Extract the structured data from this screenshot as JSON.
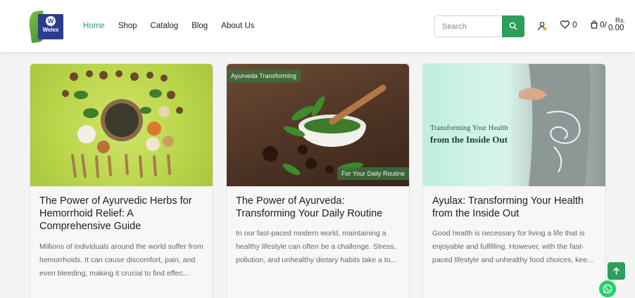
{
  "brand": {
    "logo_text": "Welex",
    "logo_badge": "W"
  },
  "nav": [
    {
      "label": "Home",
      "active": true
    },
    {
      "label": "Shop",
      "active": false
    },
    {
      "label": "Catalog",
      "active": false
    },
    {
      "label": "Blog",
      "active": false
    },
    {
      "label": "About Us",
      "active": false
    }
  ],
  "search": {
    "placeholder": "Search",
    "value": ""
  },
  "header_actions": {
    "wishlist_count": "0",
    "cart_count": "0/",
    "cart_currency": "Rs.",
    "cart_total": "0.00"
  },
  "cards": [
    {
      "title": "The Power of Ayurvedic Herbs for Hemorrhoid Relief: A Comprehensive Guide",
      "excerpt": "Millions of individuals around the world suffer from hemorrhoids. It can cause discomfort, pain, and even bleeding, making it crucial to find effec..."
    },
    {
      "title": "The Power of Ayurveda: Transforming Your Daily Routine",
      "excerpt": "In our fast-paced modern world, maintaining a healthy lifestyle can often be a challenge. Stress, pollution, and unhealthy dietary habits take a to...",
      "image_tag_top": "Ayurveda Transforming",
      "image_tag_bottom": "For Your Daily Routine"
    },
    {
      "title": "Ayulax: Transforming Your Health from the Inside Out",
      "excerpt": "Good health is necessary for living a life that is enjoyable and fulfilling. However, with the fast-paced lifestyle and unhealthy food choices, kee...",
      "image_heading_line1": "Transforming Your Health",
      "image_heading_line2": "from the Inside Out"
    }
  ],
  "colors": {
    "accent": "#2e9e5b",
    "brand_blue": "#2c3d8f",
    "whatsapp": "#25d366"
  },
  "icons": [
    "search-icon",
    "user-icon",
    "heart-icon",
    "cart-icon",
    "arrow-up-icon",
    "whatsapp-icon"
  ]
}
